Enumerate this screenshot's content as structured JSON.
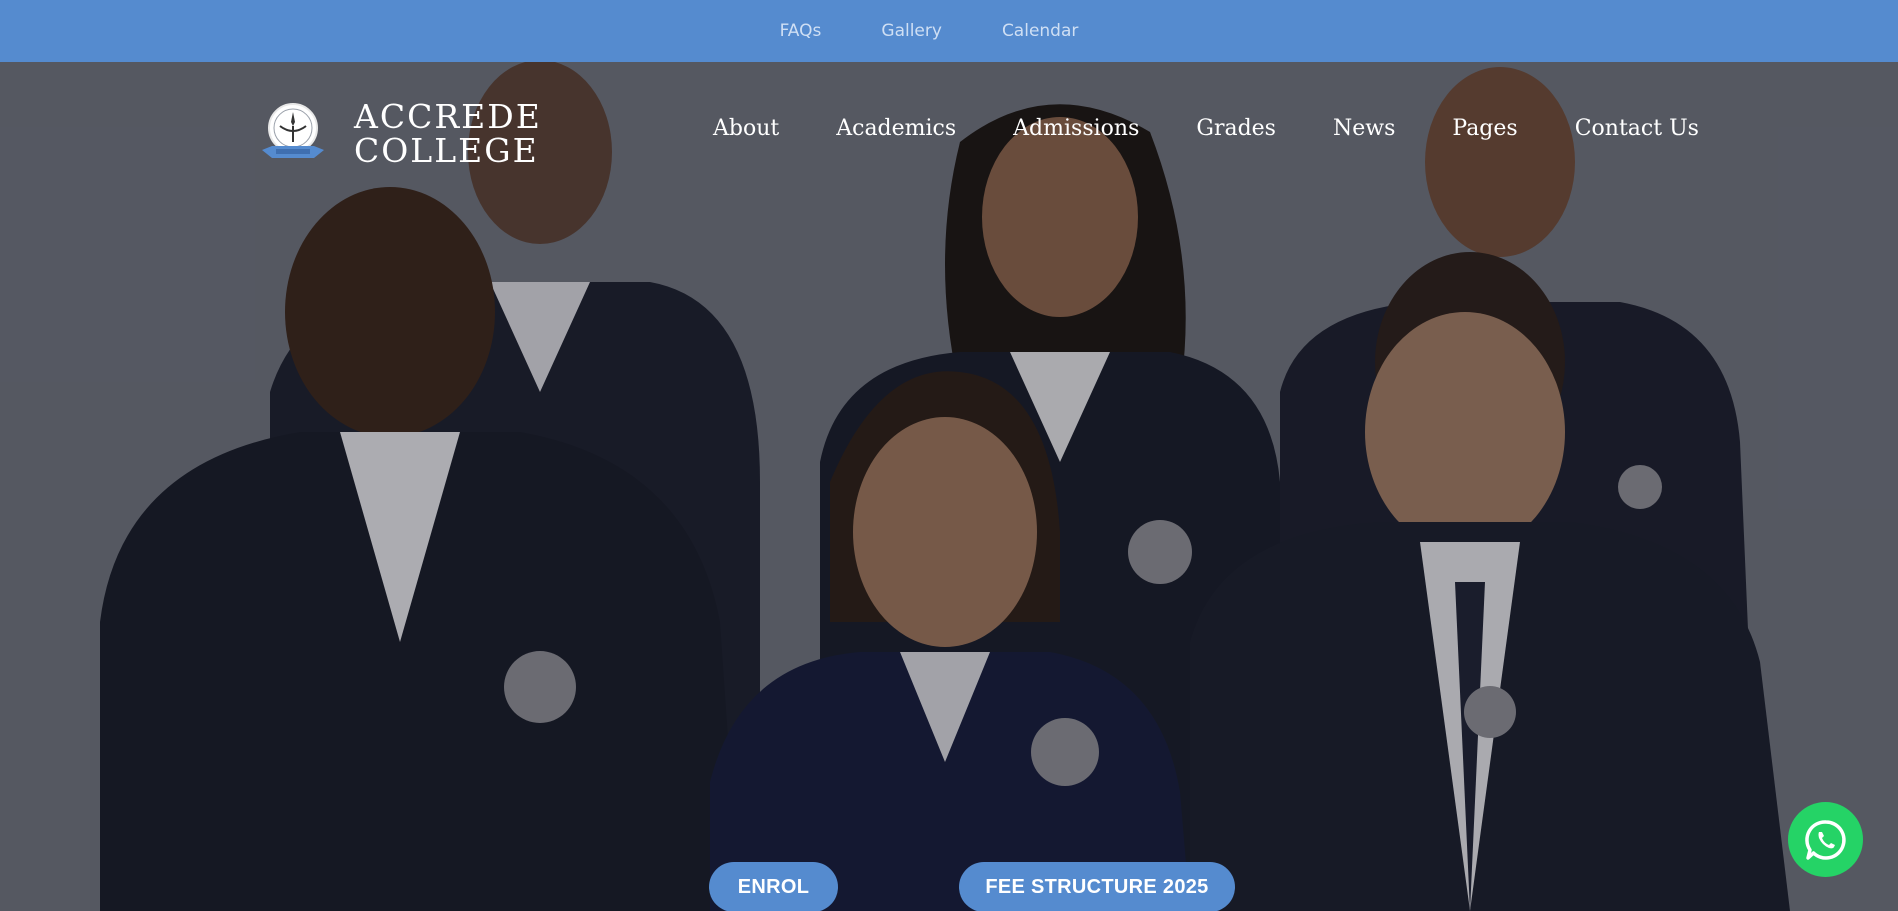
{
  "topbar": {
    "links": [
      {
        "label": "FAQs"
      },
      {
        "label": "Gallery"
      },
      {
        "label": "Calendar"
      }
    ]
  },
  "brand": {
    "line1": "ACCREDE",
    "line2": "COLLEGE",
    "crest_icon": "school-crest-icon"
  },
  "nav": {
    "items": [
      {
        "label": "About"
      },
      {
        "label": "Academics"
      },
      {
        "label": "Admissions"
      },
      {
        "label": "Grades"
      },
      {
        "label": "News"
      },
      {
        "label": "Pages"
      },
      {
        "label": "Contact Us"
      }
    ]
  },
  "hero": {
    "image": "students-in-uniform-photo",
    "buttons": {
      "enrol": "ENROL",
      "fee": "FEE STRUCTURE 2025"
    }
  },
  "whatsapp": {
    "icon": "whatsapp-icon"
  },
  "colors": {
    "accent": "#558bcf",
    "whatsapp": "#25d366"
  }
}
